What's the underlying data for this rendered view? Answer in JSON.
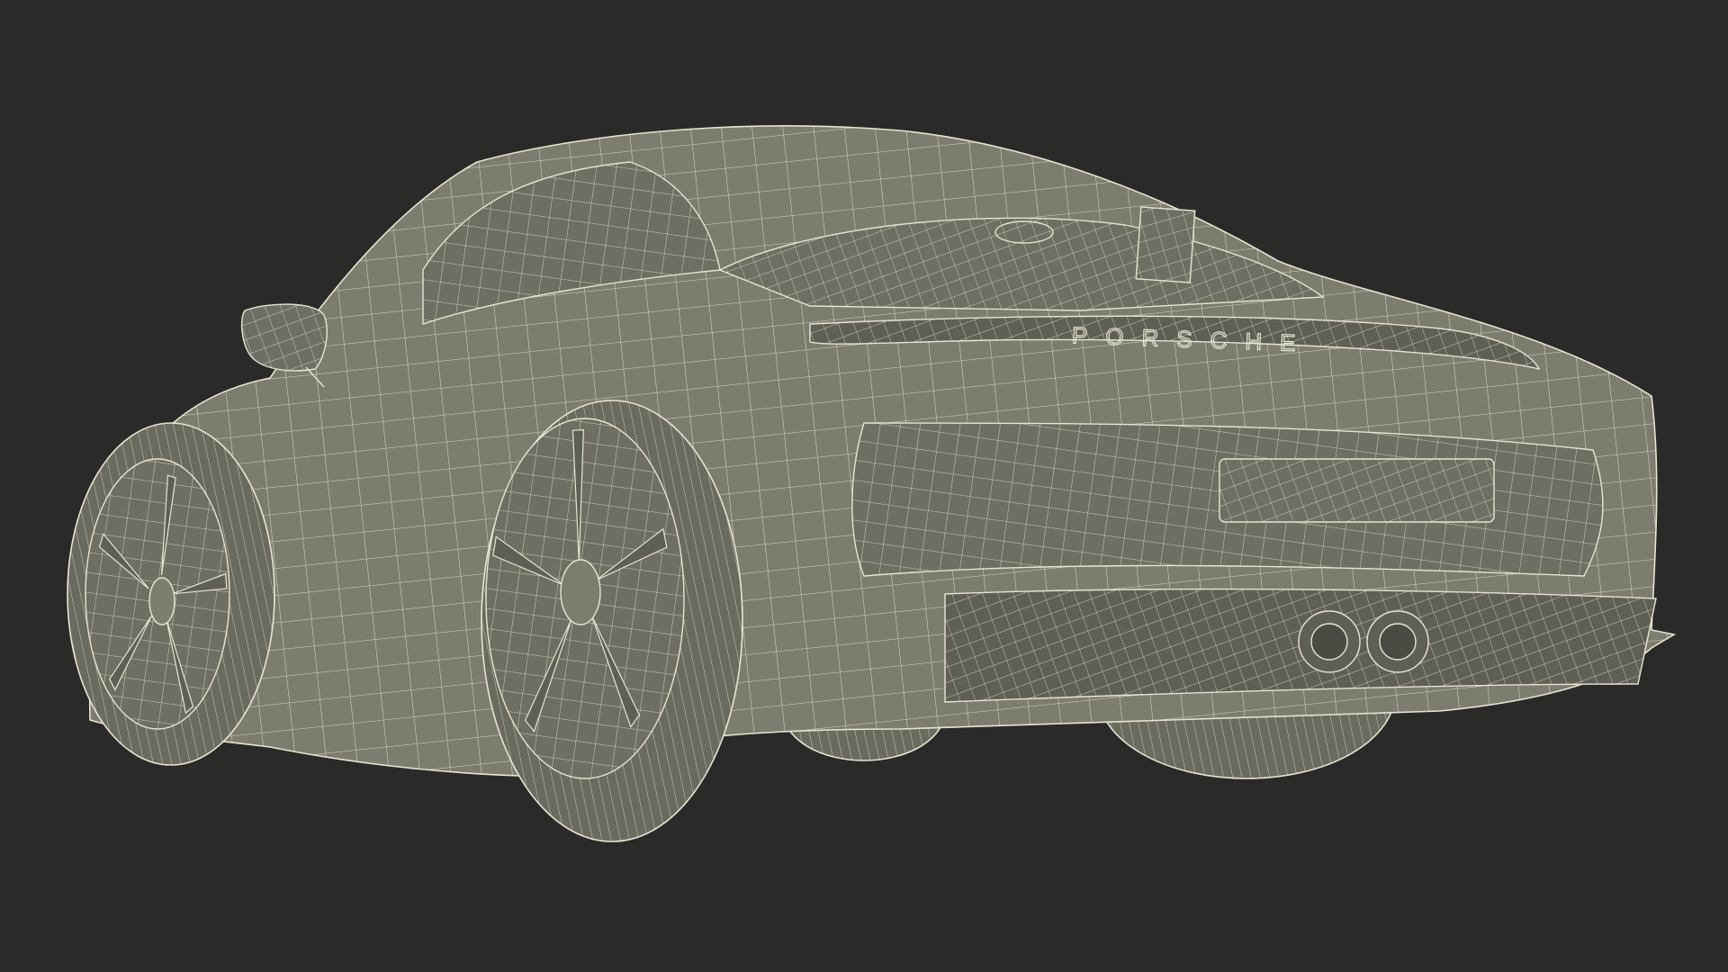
{
  "scene": {
    "subject": "car-wireframe-render",
    "colors": {
      "background": "#2a2a29",
      "body_fill": "#7c7d6e",
      "body_shade": "#6e6f62",
      "dark_fill": "#5f6055",
      "wire": "#e6e4d3",
      "wire_soft": "#cfcdbd",
      "tire": "#6a6b5f"
    }
  },
  "badge": {
    "text": "PORSCHE"
  }
}
